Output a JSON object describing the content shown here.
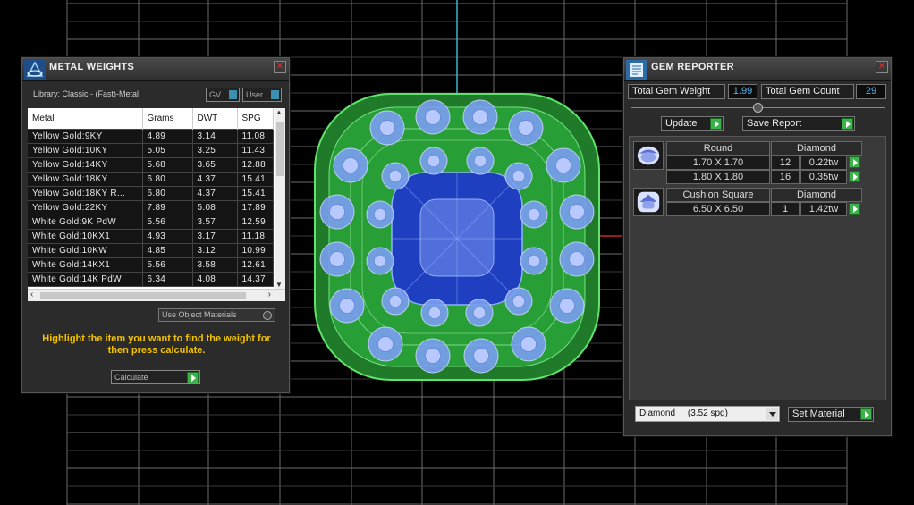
{
  "colors": {
    "grid": "#6b6b6b",
    "gem_blue": "#3b63e6",
    "wire_green": "#37c243",
    "accent_green": "#3bb34a",
    "value_blue": "#5ab3e8",
    "hint_yellow": "#f2c200"
  },
  "metal_weights": {
    "title": "METAL WEIGHTS",
    "title_icon": "rings-logo-icon",
    "library": "Library: Classic - (Fast)-Metal",
    "gv_label": "GV",
    "user_label": "User",
    "columns": [
      "Metal",
      "Grams",
      "DWT",
      "SPG"
    ],
    "rows": [
      [
        "Yellow Gold:9KY",
        "4.89",
        "3.14",
        "11.08"
      ],
      [
        "Yellow Gold:10KY",
        "5.05",
        "3.25",
        "11.43"
      ],
      [
        "Yellow Gold:14KY",
        "5.68",
        "3.65",
        "12.88"
      ],
      [
        "Yellow Gold:18KY",
        "6.80",
        "4.37",
        "15.41"
      ],
      [
        "Yellow Gold:18KY R...",
        "6.80",
        "4.37",
        "15.41"
      ],
      [
        "Yellow Gold:22KY",
        "7.89",
        "5.08",
        "17.89"
      ],
      [
        "White Gold:9K PdW",
        "5.56",
        "3.57",
        "12.59"
      ],
      [
        "White Gold:10KX1",
        "4.93",
        "3.17",
        "11.18"
      ],
      [
        "White Gold:10KW",
        "4.85",
        "3.12",
        "10.99"
      ],
      [
        "White Gold:14KX1",
        "5.56",
        "3.58",
        "12.61"
      ],
      [
        "White Gold:14K PdW",
        "6.34",
        "4.08",
        "14.37"
      ]
    ],
    "use_object_materials": "Use Object Materials",
    "hint": "Highlight the item you want to find the weight for then press calculate.",
    "calculate_label": "Calculate"
  },
  "gem_reporter": {
    "title": "GEM REPORTER",
    "title_icon": "report-icon",
    "total_weight_label": "Total Gem Weight",
    "total_weight_value": "1.99",
    "total_count_label": "Total Gem Count",
    "total_count_value": "29",
    "update_label": "Update",
    "save_report_label": "Save Report",
    "gems": [
      {
        "shape": "Round",
        "material": "Diamond",
        "sizes": [
          {
            "size": "1.70 X 1.70",
            "count": "12",
            "weight": "0.22tw"
          },
          {
            "size": "1.80 X 1.80",
            "count": "16",
            "weight": "0.35tw"
          }
        ]
      },
      {
        "shape": "Cushion Square",
        "material": "Diamond",
        "sizes": [
          {
            "size": "6.50 X 6.50",
            "count": "1",
            "weight": "1.42tw"
          }
        ]
      }
    ],
    "material_select": "Diamond     (3.52 spg)",
    "set_material_label": "Set Material"
  }
}
